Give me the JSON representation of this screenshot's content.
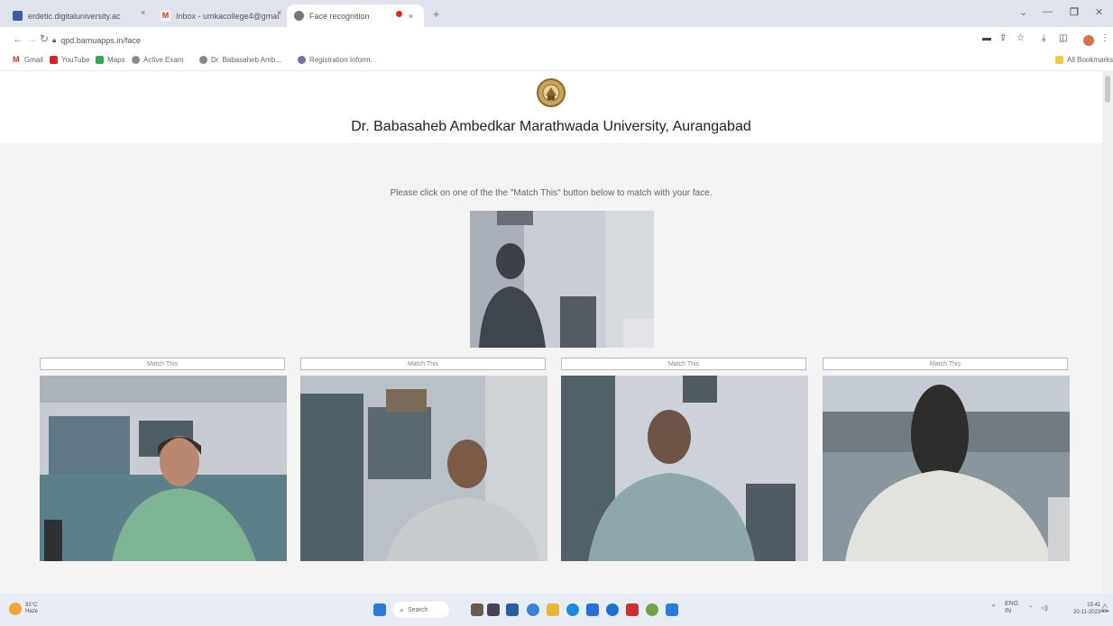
{
  "browser": {
    "tabs": [
      {
        "title": "erdetic.digitaluniversity.ac",
        "active": false,
        "icon": "page-icon"
      },
      {
        "title": "Inbox - umkacollege4@gmail...",
        "active": false,
        "icon": "gmail-icon"
      },
      {
        "title": "Face recognition",
        "active": true,
        "icon": "globe-icon"
      }
    ],
    "tab_close_glyph": "×",
    "new_tab_glyph": "+",
    "url": "qpd.bamuapps.in/face",
    "bookmarks": [
      {
        "label": "Gmail",
        "icon": "gmail-icon"
      },
      {
        "label": "YouTube",
        "icon": "youtube-icon"
      },
      {
        "label": "Maps",
        "icon": "maps-icon"
      },
      {
        "label": "Active Exam",
        "icon": "globe-icon"
      },
      {
        "label": "Dr. Babasaheb Amb...",
        "icon": "globe-icon"
      },
      {
        "label": "Registration Inform...",
        "icon": "globe-icon"
      }
    ],
    "all_bookmarks": "All Bookmarks"
  },
  "page": {
    "university": "Dr. Babasaheb Ambedkar Marathwada University, Aurangabad",
    "instruction": "Please click on one of the the \"Match This\" button below to match with your face.",
    "match_button_label": "Match This",
    "candidates": [
      {
        "button": "Match This"
      },
      {
        "button": "Match This"
      },
      {
        "button": "Match This"
      },
      {
        "button": "Match This"
      }
    ]
  },
  "taskbar": {
    "weather_temp": "31°C",
    "weather_desc": "Haze",
    "search_placeholder": "Search",
    "language": "ENG",
    "region": "IN",
    "time": "15:41",
    "date": "20-11-2023"
  },
  "colors": {
    "accent": "#1a73e8",
    "tabstrip": "#dfe4ec",
    "page_bg": "#f4f4f4",
    "recording_dot": "#d93025"
  }
}
